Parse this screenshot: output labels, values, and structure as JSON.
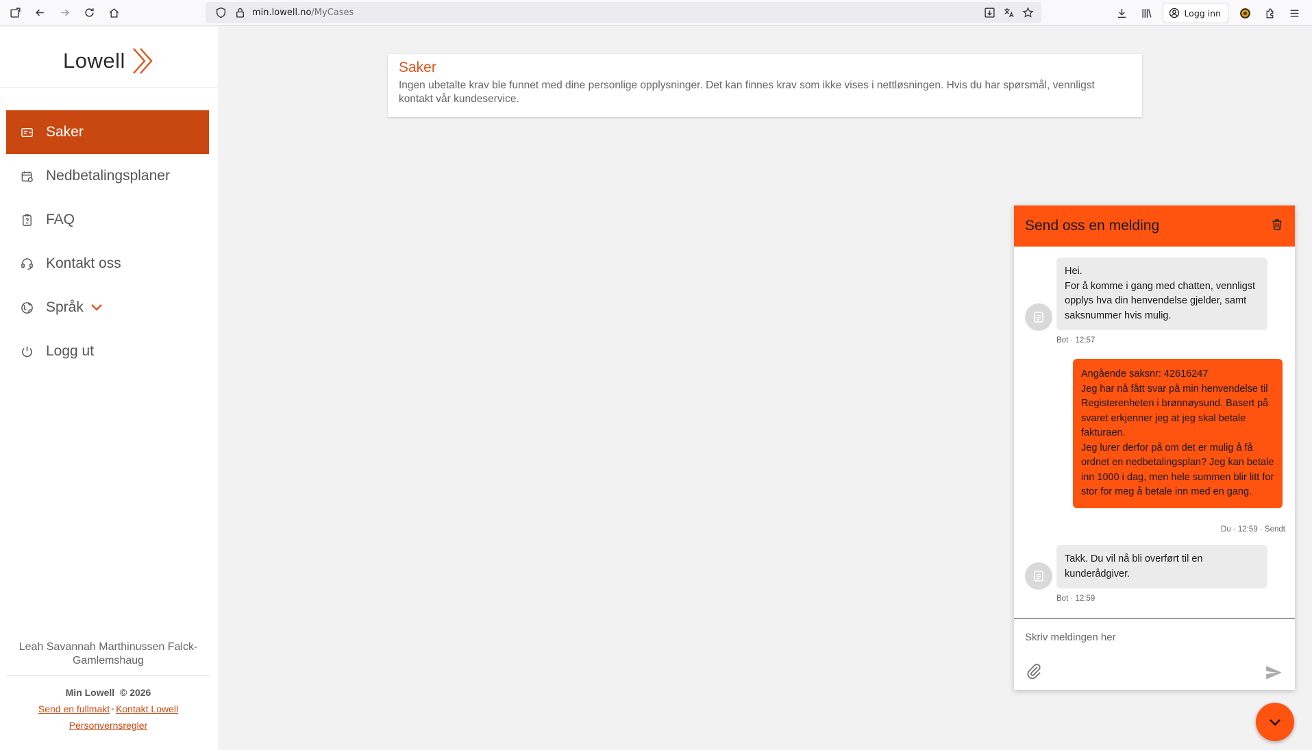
{
  "browser": {
    "url_host": "min.lowell.no",
    "url_path": "/MyCases",
    "login_label": "Logg inn"
  },
  "sidebar": {
    "logo_text": "Lowell",
    "items": [
      {
        "label": "Saker",
        "icon": "cases-icon",
        "active": true
      },
      {
        "label": "Nedbetalingsplaner",
        "icon": "calendar-icon",
        "active": false
      },
      {
        "label": "FAQ",
        "icon": "faq-icon",
        "active": false
      },
      {
        "label": "Kontakt oss",
        "icon": "headset-icon",
        "active": false
      },
      {
        "label": "Språk",
        "icon": "globe-icon",
        "active": false
      },
      {
        "label": "Logg ut",
        "icon": "power-icon",
        "active": false
      }
    ],
    "user_name": "Leah Savannah Marthinussen Falck-Gamlemshaug",
    "footer": {
      "brand": "Min Lowell",
      "copyright": "© 2026",
      "link_proxy": "Send en fullmakt",
      "link_contact": "Kontakt Lowell",
      "link_privacy": "Personvernsregler"
    }
  },
  "main": {
    "case_title": "Saker",
    "case_text": "Ingen ubetalte krav ble funnet med dine personlige opplysninger. Det kan finnes krav som ikke vises i nettløsningen. Hvis du har spørsmål, vennligst kontakt vår kundeservice."
  },
  "chat": {
    "title": "Send oss en melding",
    "messages": [
      {
        "from": "bot",
        "text": "Hei.\nFor å komme i gang med chatten, vennligst opplys hva din henvendelse gjelder, samt saksnummer hvis mulig.",
        "meta": "Bot · 12:57"
      },
      {
        "from": "user",
        "text": "Angående saksnr: 42616247\nJeg har nå fått svar på min henvendelse til Registerenheten i brønnøysund. Basert på svaret erkjenner jeg at jeg skal betale fakturaen.\nJeg lurer derfor på om det er mulig å få ordnet en nedbetalingsplan? Jeg kan betale inn 1000 i dag, men hele summen blir litt for stor for meg å betale inn med en gang.",
        "meta": "Du · 12:59 · Sendt"
      },
      {
        "from": "bot",
        "text": "Takk. Du vil nå bli overført til en kunderådgiver.",
        "meta": "Bot · 12:59"
      }
    ],
    "input_placeholder": "Skriv meldingen her"
  },
  "colors": {
    "brand_orange": "#ff5310",
    "active_nav": "#c94811"
  }
}
